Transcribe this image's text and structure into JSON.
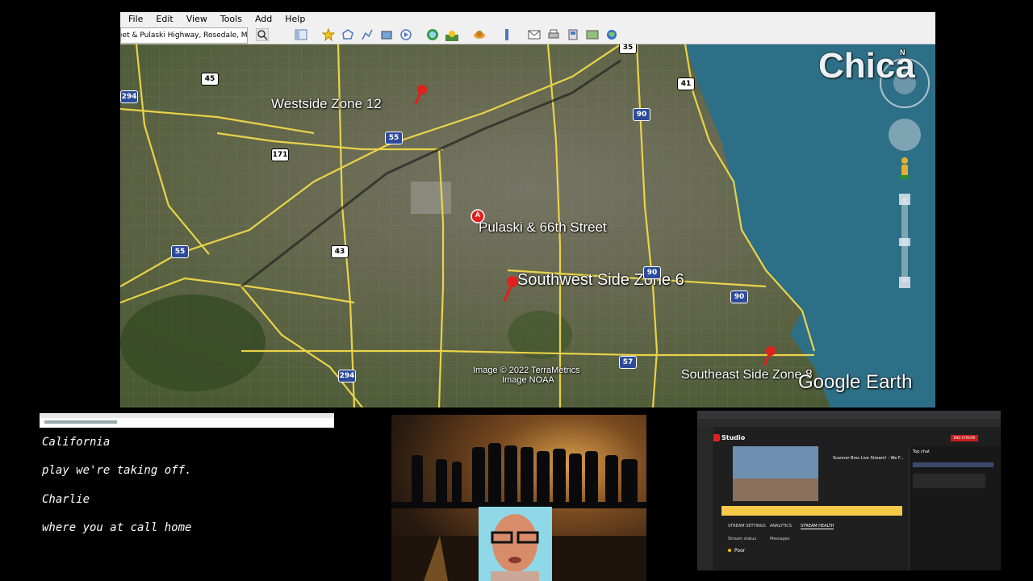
{
  "google_earth": {
    "menu": [
      "File",
      "Edit",
      "View",
      "Tools",
      "Add",
      "Help"
    ],
    "search_value": "eet & Pulaski Highway, Rosedale, MD",
    "labels": {
      "westside": "Westside Zone 12",
      "pulaski": "Pulaski & 66th Street",
      "pulaski_marker": "A",
      "southwest": "Southwest Side Zone 6",
      "southeast": "Southeast Side Zone 8",
      "city": "Chica",
      "copyright_1": "Image © 2022 TerraMetrics",
      "copyright_2": "Image NOAA",
      "brand": "Google Earth",
      "north": "N"
    },
    "shields": {
      "i294_w": "294",
      "us45": "45",
      "i55_n": "55",
      "us171": "171",
      "i55_w": "55",
      "us43": "43",
      "i294_s": "294",
      "i90_n": "90",
      "us41": "41",
      "i90_m": "90",
      "i90_e": "90",
      "i57": "57",
      "i35": "35"
    },
    "colors": {
      "water": "#2d6f86",
      "road": "#f1d94a",
      "pin": "#e0201b"
    }
  },
  "chat": {
    "lines": [
      "California",
      "play we're taking off.",
      "Charlie",
      "where you at call home"
    ]
  },
  "studio": {
    "title": "Studio",
    "end_stream": "END STREAM",
    "stream_title": "Scanner Bros Live Stream! - We F...",
    "tabs": [
      "STREAM SETTINGS",
      "ANALYTICS",
      "STREAM HEALTH"
    ],
    "stream_status_label": "Stream status",
    "stream_status_value": "Poor",
    "messages_label": "Messages",
    "top_chat": "Top chat"
  }
}
